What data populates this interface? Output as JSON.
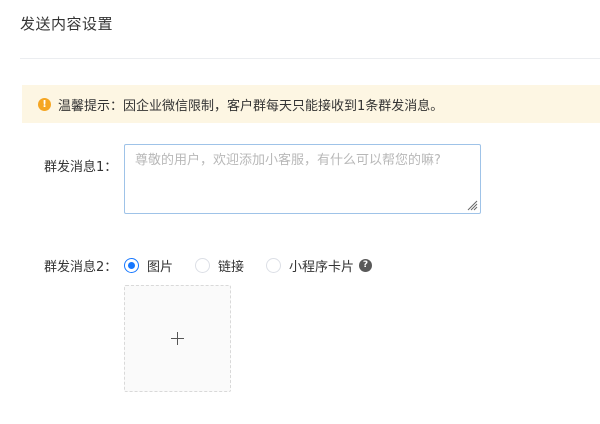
{
  "header": {
    "title": "发送内容设置"
  },
  "notice": {
    "icon": "warning-icon",
    "icon_glyph": "!",
    "text": "温馨提示：因企业微信限制，客户群每天只能接收到1条群发消息。",
    "color": "#fdf6e3",
    "icon_color": "#f5a623"
  },
  "message1": {
    "label": "群发消息1：",
    "value": "",
    "placeholder": "尊敬的用户，欢迎添加小客服，有什么可以帮您的嘛?"
  },
  "message2": {
    "label": "群发消息2：",
    "options": [
      {
        "label": "图片",
        "checked": true
      },
      {
        "label": "链接",
        "checked": false
      },
      {
        "label": "小程序卡片",
        "checked": false
      }
    ],
    "help_icon_glyph": "?",
    "accent_color": "#1677ff",
    "upload": {
      "icon": "plus-icon"
    }
  }
}
